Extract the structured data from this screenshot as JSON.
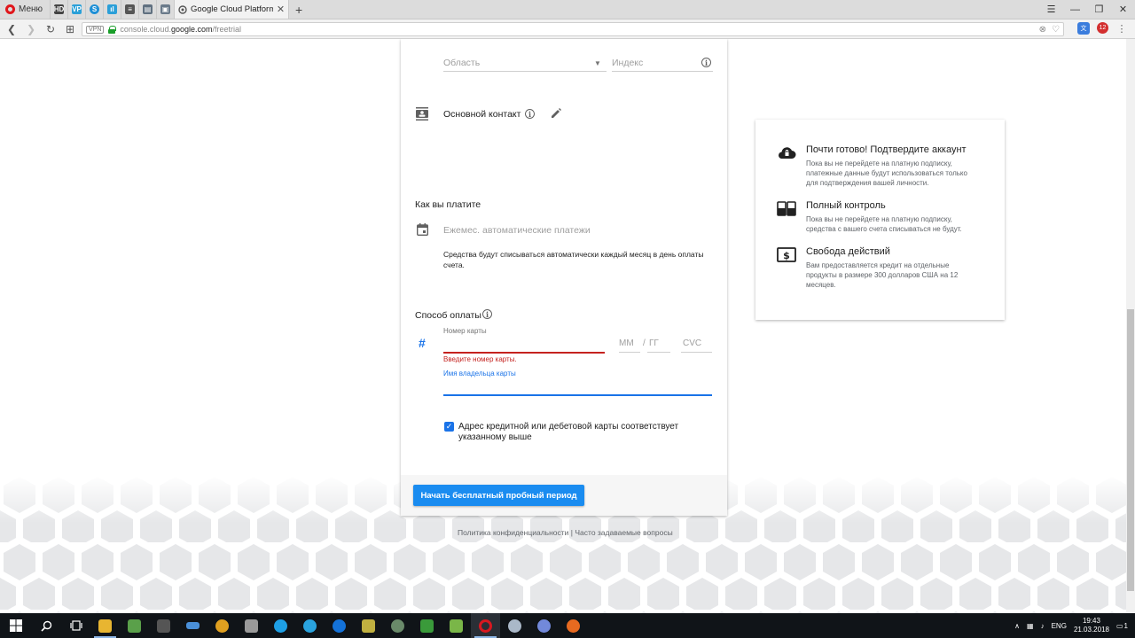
{
  "browser": {
    "menu_label": "Меню",
    "active_tab_title": "Google Cloud Platform – C",
    "pinned_tabs": [
      {
        "name": "hd-icon",
        "text": "HD",
        "color": "#444444"
      },
      {
        "name": "vp-icon",
        "text": "VP",
        "color": "#2aa0d8"
      },
      {
        "name": "shazam-icon",
        "text": "S",
        "color": "#1e8fd6"
      },
      {
        "name": "stats-icon",
        "text": "ıl",
        "color": "#2b9fd8"
      },
      {
        "name": "document-icon",
        "text": "≡",
        "color": "#555555"
      },
      {
        "name": "printer-icon",
        "text": "▤",
        "color": "#607080"
      },
      {
        "name": "image-icon",
        "text": "▣",
        "color": "#6a7a8a"
      }
    ],
    "url_prefix": "console.cloud.",
    "url_domain": "google.com",
    "url_path": "/freetrial",
    "vpn_label": "VPN",
    "adblock_count": "12"
  },
  "form": {
    "region_placeholder": "Область",
    "zip_placeholder": "Индекс",
    "contact_label": "Основной контакт",
    "how_you_pay_heading": "Как вы платите",
    "payment_type_placeholder": "Ежемес. автоматические платежи",
    "payment_note": "Средства будут списываться автоматически каждый месяц в день оплаты счета.",
    "payment_method_heading": "Способ оплаты",
    "card_number_label": "Номер карты",
    "card_number_error": "Введите номер карты.",
    "month_placeholder": "ММ",
    "slash": "/",
    "year_placeholder": "ГГ",
    "cvc_placeholder": "CVC",
    "cardholder_label": "Имя владельца карты",
    "address_checkbox_label": "Адрес кредитной или дебетовой карты соответствует указанному выше",
    "submit_label": "Начать бесплатный пробный период"
  },
  "info": {
    "items": [
      {
        "title": "Почти готово! Подтвердите аккаунт",
        "desc": "Пока вы не перейдете на платную подписку, платежные данные будут использоваться только для подтверждения вашей личности."
      },
      {
        "title": "Полный контроль",
        "desc": "Пока вы не перейдете на платную подписку, средства с вашего счета списываться не будут."
      },
      {
        "title": "Свобода действий",
        "desc": "Вам предоставляется кредит на отдельные продукты в размере 300 долларов США на 12 месяцев."
      }
    ]
  },
  "footer": {
    "privacy_link": "Политика конфиденциальности",
    "separator": "|",
    "faq_link": "Часто задаваемые вопросы"
  },
  "taskbar": {
    "language": "ENG",
    "time": "19:43",
    "date": "21.03.2018",
    "notification_count": "1",
    "apps": [
      {
        "name": "file-explorer-icon",
        "color": "#e8b531"
      },
      {
        "name": "xmind-icon",
        "color": "#5aa04a"
      },
      {
        "name": "calculator-icon",
        "color": "#555555"
      },
      {
        "name": "scanner-icon",
        "color": "#4a90d9"
      },
      {
        "name": "chrome-icon",
        "color": "#e0a020"
      },
      {
        "name": "tool-icon",
        "color": "#9a9a9a"
      },
      {
        "name": "skype-icon",
        "color": "#1ea0e6"
      },
      {
        "name": "telegram-icon",
        "color": "#2aa3de"
      },
      {
        "name": "teamviewer-icon",
        "color": "#1472d8"
      },
      {
        "name": "star-app-icon",
        "color": "#c0b040"
      },
      {
        "name": "globe-app-icon",
        "color": "#6a8a6a"
      },
      {
        "name": "house-app-icon",
        "color": "#3a9a3a"
      },
      {
        "name": "notepad-icon",
        "color": "#7ab648"
      },
      {
        "name": "opera-taskbar-icon",
        "color": "#d81820"
      },
      {
        "name": "settings-app-icon",
        "color": "#aab8c8"
      },
      {
        "name": "discord-icon",
        "color": "#7289da"
      },
      {
        "name": "firefox-icon",
        "color": "#e86a20"
      }
    ]
  }
}
